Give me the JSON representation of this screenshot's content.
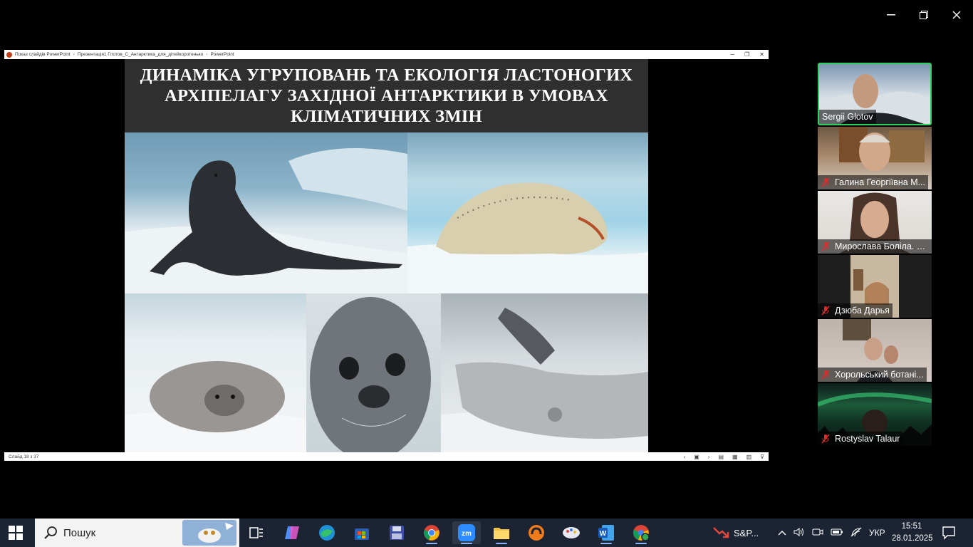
{
  "zoom_window": {
    "controls": [
      "minimize",
      "restore",
      "close"
    ]
  },
  "powerpoint": {
    "titlebar": {
      "segments": [
        "Показ слайдів PowerPoint",
        "Презентація1 Глотов_С_Антарктика_для_дітейкоротенько",
        "PowerPoint"
      ]
    },
    "slide": {
      "title_lines": [
        "ДИНАМІКА УГРУПОВАНЬ ТА ЕКОЛОГІЯ ЛАСТОНОГИХ",
        "АРХІПЕЛАГУ ЗАХІДНОЇ АНТАРКТИКИ В УМОВАХ",
        "КЛІМАТИЧНИХ ЗМІН"
      ]
    },
    "status": {
      "slide_counter": "Слайд 18 з 37"
    }
  },
  "participants": [
    {
      "name": "Sergii Glotov",
      "muted": false,
      "active": true
    },
    {
      "name": "Галина Георгіївна М...",
      "muted": true,
      "active": false
    },
    {
      "name": "Мирослава Боліла. В...",
      "muted": true,
      "active": false
    },
    {
      "name": "Дзюба Дарья",
      "muted": true,
      "active": false
    },
    {
      "name": "Хорольський ботані...",
      "muted": true,
      "active": false
    },
    {
      "name": "Rostyslav Talaur",
      "muted": true,
      "active": false
    }
  ],
  "taskbar": {
    "search_placeholder": "Пошук",
    "apps": [
      "task-view",
      "copilot",
      "edge",
      "store",
      "save-app",
      "chrome",
      "zoom",
      "file-explorer",
      "orange-app",
      "paint-app",
      "word",
      "chrome-profile"
    ],
    "sp_label": "S&P...",
    "lang": "УКР",
    "time": "15:51",
    "date": "28.01.2025"
  },
  "colors": {
    "accent_active_speaker": "#2ad15a",
    "taskbar_bg": "#1c2433",
    "mic_off": "#e02b2b"
  }
}
